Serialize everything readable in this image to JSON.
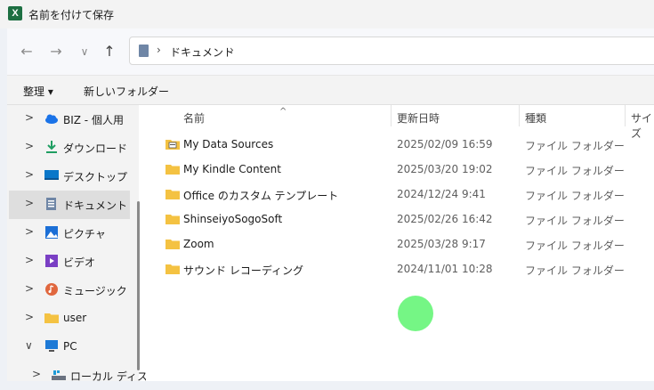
{
  "window": {
    "title": "名前を付けて保存",
    "app_icon_letter": "X"
  },
  "nav": {
    "back": "←",
    "forward": "→",
    "recent": "∨",
    "up": "↑"
  },
  "address": {
    "separator": "›",
    "location": "ドキュメント",
    "trailing": "›"
  },
  "toolbar": {
    "organize": "整理 ▾",
    "new_folder": "新しいフォルダー"
  },
  "sidebar": {
    "items": [
      {
        "label": "BIZ - 個人用",
        "chevron": ">",
        "icon": "cloud-icon"
      },
      {
        "label": "ダウンロード",
        "chevron": ">",
        "icon": "download-icon"
      },
      {
        "label": "デスクトップ",
        "chevron": ">",
        "icon": "desktop-icon"
      },
      {
        "label": "ドキュメント",
        "chevron": ">",
        "icon": "documents-icon",
        "selected": true
      },
      {
        "label": "ピクチャ",
        "chevron": ">",
        "icon": "pictures-icon"
      },
      {
        "label": "ビデオ",
        "chevron": ">",
        "icon": "videos-icon"
      },
      {
        "label": "ミュージック",
        "chevron": ">",
        "icon": "music-icon"
      },
      {
        "label": "user",
        "chevron": ">",
        "icon": "folder-icon"
      },
      {
        "label": "PC",
        "chevron": "∨",
        "icon": "pc-icon"
      },
      {
        "label": "ローカル ディスク",
        "chevron": ">",
        "icon": "disk-icon"
      }
    ]
  },
  "columns": {
    "sort_indicator": "^",
    "name": "名前",
    "date": "更新日時",
    "type": "種類",
    "size": "サイズ"
  },
  "files": [
    {
      "name": "My Data Sources",
      "date": "2025/02/09 16:59",
      "type": "ファイル フォルダー",
      "icon": "datasource-folder-icon"
    },
    {
      "name": "My Kindle Content",
      "date": "2025/03/20 19:02",
      "type": "ファイル フォルダー",
      "icon": "folder-icon"
    },
    {
      "name": "Office のカスタム テンプレート",
      "date": "2024/12/24 9:41",
      "type": "ファイル フォルダー",
      "icon": "folder-icon"
    },
    {
      "name": "ShinseiyoSogoSoft",
      "date": "2025/02/26 16:42",
      "type": "ファイル フォルダー",
      "icon": "folder-icon"
    },
    {
      "name": "Zoom",
      "date": "2025/03/28 9:17",
      "type": "ファイル フォルダー",
      "icon": "folder-icon"
    },
    {
      "name": "サウンド レコーディング",
      "date": "2024/11/01 10:28",
      "type": "ファイル フォルダー",
      "icon": "folder-icon"
    }
  ],
  "colors": {
    "folder": "#f4c242",
    "accent": "#0067c0",
    "cursor": "#6ef57e"
  }
}
